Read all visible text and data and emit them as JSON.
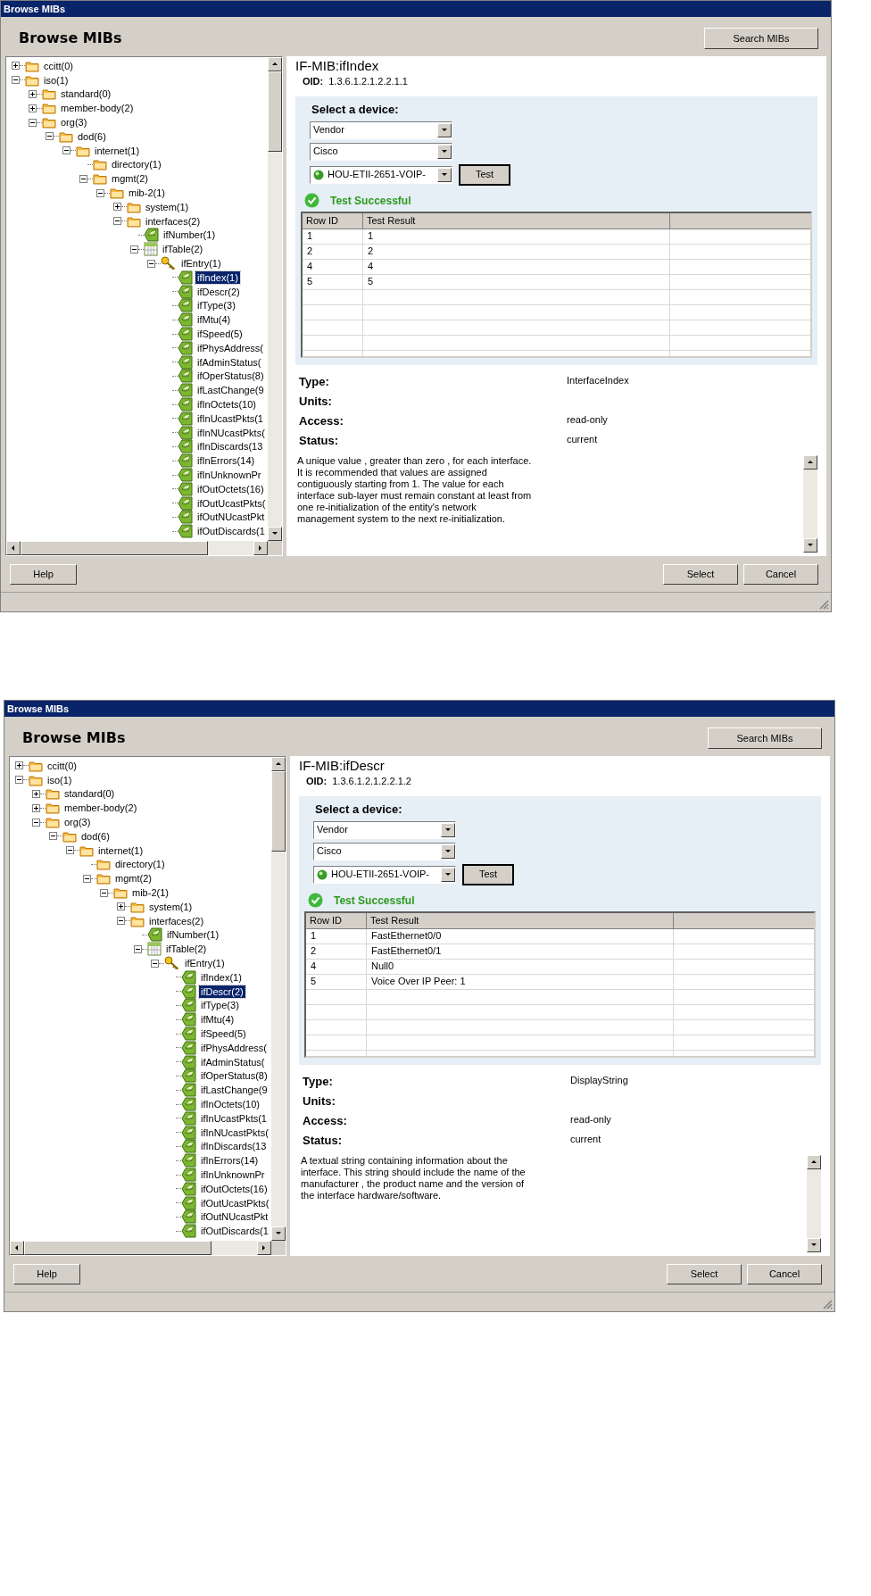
{
  "dialogs": [
    {
      "title": "Browse MIBs",
      "heading": "Browse MIBs",
      "search_button": "Search MIBs",
      "tree": [
        {
          "label": "ccitt(0)",
          "kind": "folder",
          "expanded": false,
          "selected": false
        },
        {
          "label": "iso(1)",
          "kind": "folder",
          "expanded": true,
          "selected": false,
          "children": [
            {
              "label": "standard(0)",
              "kind": "folder",
              "expanded": false,
              "selected": false
            },
            {
              "label": "member-body(2)",
              "kind": "folder",
              "expanded": false,
              "selected": false
            },
            {
              "label": "org(3)",
              "kind": "folder",
              "expanded": true,
              "selected": false,
              "children": [
                {
                  "label": "dod(6)",
                  "kind": "folder",
                  "expanded": true,
                  "selected": false,
                  "children": [
                    {
                      "label": "internet(1)",
                      "kind": "folder",
                      "expanded": true,
                      "selected": false,
                      "children": [
                        {
                          "label": "directory(1)",
                          "kind": "folder",
                          "selected": false
                        },
                        {
                          "label": "mgmt(2)",
                          "kind": "folder",
                          "expanded": true,
                          "selected": false,
                          "children": [
                            {
                              "label": "mib-2(1)",
                              "kind": "folder",
                              "expanded": true,
                              "selected": false,
                              "children": [
                                {
                                  "label": "system(1)",
                                  "kind": "folder",
                                  "expanded": false,
                                  "selected": false
                                },
                                {
                                  "label": "interfaces(2)",
                                  "kind": "folder",
                                  "expanded": true,
                                  "selected": false,
                                  "children": [
                                    {
                                      "label": "ifNumber(1)",
                                      "kind": "leaf",
                                      "selected": false
                                    },
                                    {
                                      "label": "ifTable(2)",
                                      "kind": "table",
                                      "expanded": true,
                                      "selected": false,
                                      "children": [
                                        {
                                          "label": "ifEntry(1)",
                                          "kind": "key",
                                          "expanded": true,
                                          "selected": false,
                                          "children": [
                                            {
                                              "label": "ifIndex(1)",
                                              "kind": "leaf",
                                              "selected": true
                                            },
                                            {
                                              "label": "ifDescr(2)",
                                              "kind": "leaf",
                                              "selected": false
                                            },
                                            {
                                              "label": "ifType(3)",
                                              "kind": "leaf",
                                              "selected": false
                                            },
                                            {
                                              "label": "ifMtu(4)",
                                              "kind": "leaf",
                                              "selected": false
                                            },
                                            {
                                              "label": "ifSpeed(5)",
                                              "kind": "leaf",
                                              "selected": false
                                            },
                                            {
                                              "label": "ifPhysAddress(",
                                              "kind": "leaf",
                                              "selected": false
                                            },
                                            {
                                              "label": "ifAdminStatus(",
                                              "kind": "leaf",
                                              "selected": false
                                            },
                                            {
                                              "label": "ifOperStatus(8)",
                                              "kind": "leaf",
                                              "selected": false
                                            },
                                            {
                                              "label": "ifLastChange(9",
                                              "kind": "leaf",
                                              "selected": false
                                            },
                                            {
                                              "label": "ifInOctets(10)",
                                              "kind": "leaf",
                                              "selected": false
                                            },
                                            {
                                              "label": "ifInUcastPkts(1",
                                              "kind": "leaf",
                                              "selected": false
                                            },
                                            {
                                              "label": "ifInNUcastPkts(",
                                              "kind": "leaf",
                                              "selected": false
                                            },
                                            {
                                              "label": "ifInDiscards(13",
                                              "kind": "leaf",
                                              "selected": false
                                            },
                                            {
                                              "label": "ifInErrors(14)",
                                              "kind": "leaf",
                                              "selected": false
                                            },
                                            {
                                              "label": "ifInUnknownPr",
                                              "kind": "leaf",
                                              "selected": false
                                            },
                                            {
                                              "label": "ifOutOctets(16)",
                                              "kind": "leaf",
                                              "selected": false
                                            },
                                            {
                                              "label": "ifOutUcastPkts(",
                                              "kind": "leaf",
                                              "selected": false
                                            },
                                            {
                                              "label": "ifOutNUcastPkt",
                                              "kind": "leaf",
                                              "selected": false
                                            },
                                            {
                                              "label": "ifOutDiscards(1",
                                              "kind": "leaf",
                                              "selected": false
                                            }
                                          ]
                                        }
                                      ]
                                    }
                                  ]
                                }
                              ]
                            }
                          ]
                        }
                      ]
                    }
                  ]
                }
              ]
            }
          ]
        }
      ],
      "object_name": "IF-MIB:ifIndex",
      "oid_label": "OID:",
      "oid": "1.3.6.1.2.1.2.2.1.1",
      "device_heading": "Select a device:",
      "vendor_select": "Vendor",
      "maker_select": "Cisco",
      "device_select": "HOU-ETII-2651-VOIP-",
      "test_button": "Test",
      "test_message": "Test Successful",
      "columns": [
        "Row ID",
        "Test Result"
      ],
      "rows": [
        [
          "1",
          "1"
        ],
        [
          "2",
          "2"
        ],
        [
          "4",
          "4"
        ],
        [
          "5",
          "5"
        ]
      ],
      "properties": [
        {
          "label": "Type:",
          "value": "InterfaceIndex"
        },
        {
          "label": "Units:"
        },
        {
          "label": "Access:",
          "value": "read-only"
        },
        {
          "label": "Status:",
          "value": "current"
        }
      ],
      "description": "A unique value , greater than zero , for each interface. It is recommended that values are assigned contiguously starting from 1. The value for each interface sub-layer must remain constant at least from one re-initialization of the entity's network management system to the next re-initialization.",
      "help_button": "Help",
      "select_button": "Select",
      "cancel_button": "Cancel"
    },
    {
      "title": "Browse MIBs",
      "heading": "Browse MIBs",
      "search_button": "Search MIBs",
      "tree": [
        {
          "label": "ccitt(0)",
          "kind": "folder",
          "expanded": false,
          "selected": false
        },
        {
          "label": "iso(1)",
          "kind": "folder",
          "expanded": true,
          "selected": false,
          "children": [
            {
              "label": "standard(0)",
              "kind": "folder",
              "expanded": false,
              "selected": false
            },
            {
              "label": "member-body(2)",
              "kind": "folder",
              "expanded": false,
              "selected": false
            },
            {
              "label": "org(3)",
              "kind": "folder",
              "expanded": true,
              "selected": false,
              "children": [
                {
                  "label": "dod(6)",
                  "kind": "folder",
                  "expanded": true,
                  "selected": false,
                  "children": [
                    {
                      "label": "internet(1)",
                      "kind": "folder",
                      "expanded": true,
                      "selected": false,
                      "children": [
                        {
                          "label": "directory(1)",
                          "kind": "folder",
                          "selected": false
                        },
                        {
                          "label": "mgmt(2)",
                          "kind": "folder",
                          "expanded": true,
                          "selected": false,
                          "children": [
                            {
                              "label": "mib-2(1)",
                              "kind": "folder",
                              "expanded": true,
                              "selected": false,
                              "children": [
                                {
                                  "label": "system(1)",
                                  "kind": "folder",
                                  "expanded": false,
                                  "selected": false
                                },
                                {
                                  "label": "interfaces(2)",
                                  "kind": "folder",
                                  "expanded": true,
                                  "selected": false,
                                  "children": [
                                    {
                                      "label": "ifNumber(1)",
                                      "kind": "leaf",
                                      "selected": false
                                    },
                                    {
                                      "label": "ifTable(2)",
                                      "kind": "table",
                                      "expanded": true,
                                      "selected": false,
                                      "children": [
                                        {
                                          "label": "ifEntry(1)",
                                          "kind": "key",
                                          "expanded": true,
                                          "selected": false,
                                          "children": [
                                            {
                                              "label": "ifIndex(1)",
                                              "kind": "leaf",
                                              "selected": false
                                            },
                                            {
                                              "label": "ifDescr(2)",
                                              "kind": "leaf",
                                              "selected": true
                                            },
                                            {
                                              "label": "ifType(3)",
                                              "kind": "leaf",
                                              "selected": false
                                            },
                                            {
                                              "label": "ifMtu(4)",
                                              "kind": "leaf",
                                              "selected": false
                                            },
                                            {
                                              "label": "ifSpeed(5)",
                                              "kind": "leaf",
                                              "selected": false
                                            },
                                            {
                                              "label": "ifPhysAddress(",
                                              "kind": "leaf",
                                              "selected": false
                                            },
                                            {
                                              "label": "ifAdminStatus(",
                                              "kind": "leaf",
                                              "selected": false
                                            },
                                            {
                                              "label": "ifOperStatus(8)",
                                              "kind": "leaf",
                                              "selected": false
                                            },
                                            {
                                              "label": "ifLastChange(9",
                                              "kind": "leaf",
                                              "selected": false
                                            },
                                            {
                                              "label": "ifInOctets(10)",
                                              "kind": "leaf",
                                              "selected": false
                                            },
                                            {
                                              "label": "ifInUcastPkts(1",
                                              "kind": "leaf",
                                              "selected": false
                                            },
                                            {
                                              "label": "ifInNUcastPkts(",
                                              "kind": "leaf",
                                              "selected": false
                                            },
                                            {
                                              "label": "ifInDiscards(13",
                                              "kind": "leaf",
                                              "selected": false
                                            },
                                            {
                                              "label": "ifInErrors(14)",
                                              "kind": "leaf",
                                              "selected": false
                                            },
                                            {
                                              "label": "ifInUnknownPr",
                                              "kind": "leaf",
                                              "selected": false
                                            },
                                            {
                                              "label": "ifOutOctets(16)",
                                              "kind": "leaf",
                                              "selected": false
                                            },
                                            {
                                              "label": "ifOutUcastPkts(",
                                              "kind": "leaf",
                                              "selected": false
                                            },
                                            {
                                              "label": "ifOutNUcastPkt",
                                              "kind": "leaf",
                                              "selected": false
                                            },
                                            {
                                              "label": "ifOutDiscards(1",
                                              "kind": "leaf",
                                              "selected": false
                                            }
                                          ]
                                        }
                                      ]
                                    }
                                  ]
                                }
                              ]
                            }
                          ]
                        }
                      ]
                    }
                  ]
                }
              ]
            }
          ]
        }
      ],
      "object_name": "IF-MIB:ifDescr",
      "oid_label": "OID:",
      "oid": "1.3.6.1.2.1.2.2.1.2",
      "device_heading": "Select a device:",
      "vendor_select": "Vendor",
      "maker_select": "Cisco",
      "device_select": "HOU-ETII-2651-VOIP-",
      "test_button": "Test",
      "test_message": "Test Successful",
      "columns": [
        "Row ID",
        "Test Result"
      ],
      "rows": [
        [
          "1",
          "FastEthernet0/0"
        ],
        [
          "2",
          "FastEthernet0/1"
        ],
        [
          "4",
          "Null0"
        ],
        [
          "5",
          "Voice Over IP Peer: 1"
        ]
      ],
      "properties": [
        {
          "label": "Type:",
          "value": "DisplayString"
        },
        {
          "label": "Units:"
        },
        {
          "label": "Access:",
          "value": "read-only"
        },
        {
          "label": "Status:",
          "value": "current"
        }
      ],
      "description": "A textual string containing information about the interface. This string should include the name of the manufacturer , the product name and the version of the interface hardware/software.",
      "help_button": "Help",
      "select_button": "Select",
      "cancel_button": "Cancel"
    }
  ]
}
